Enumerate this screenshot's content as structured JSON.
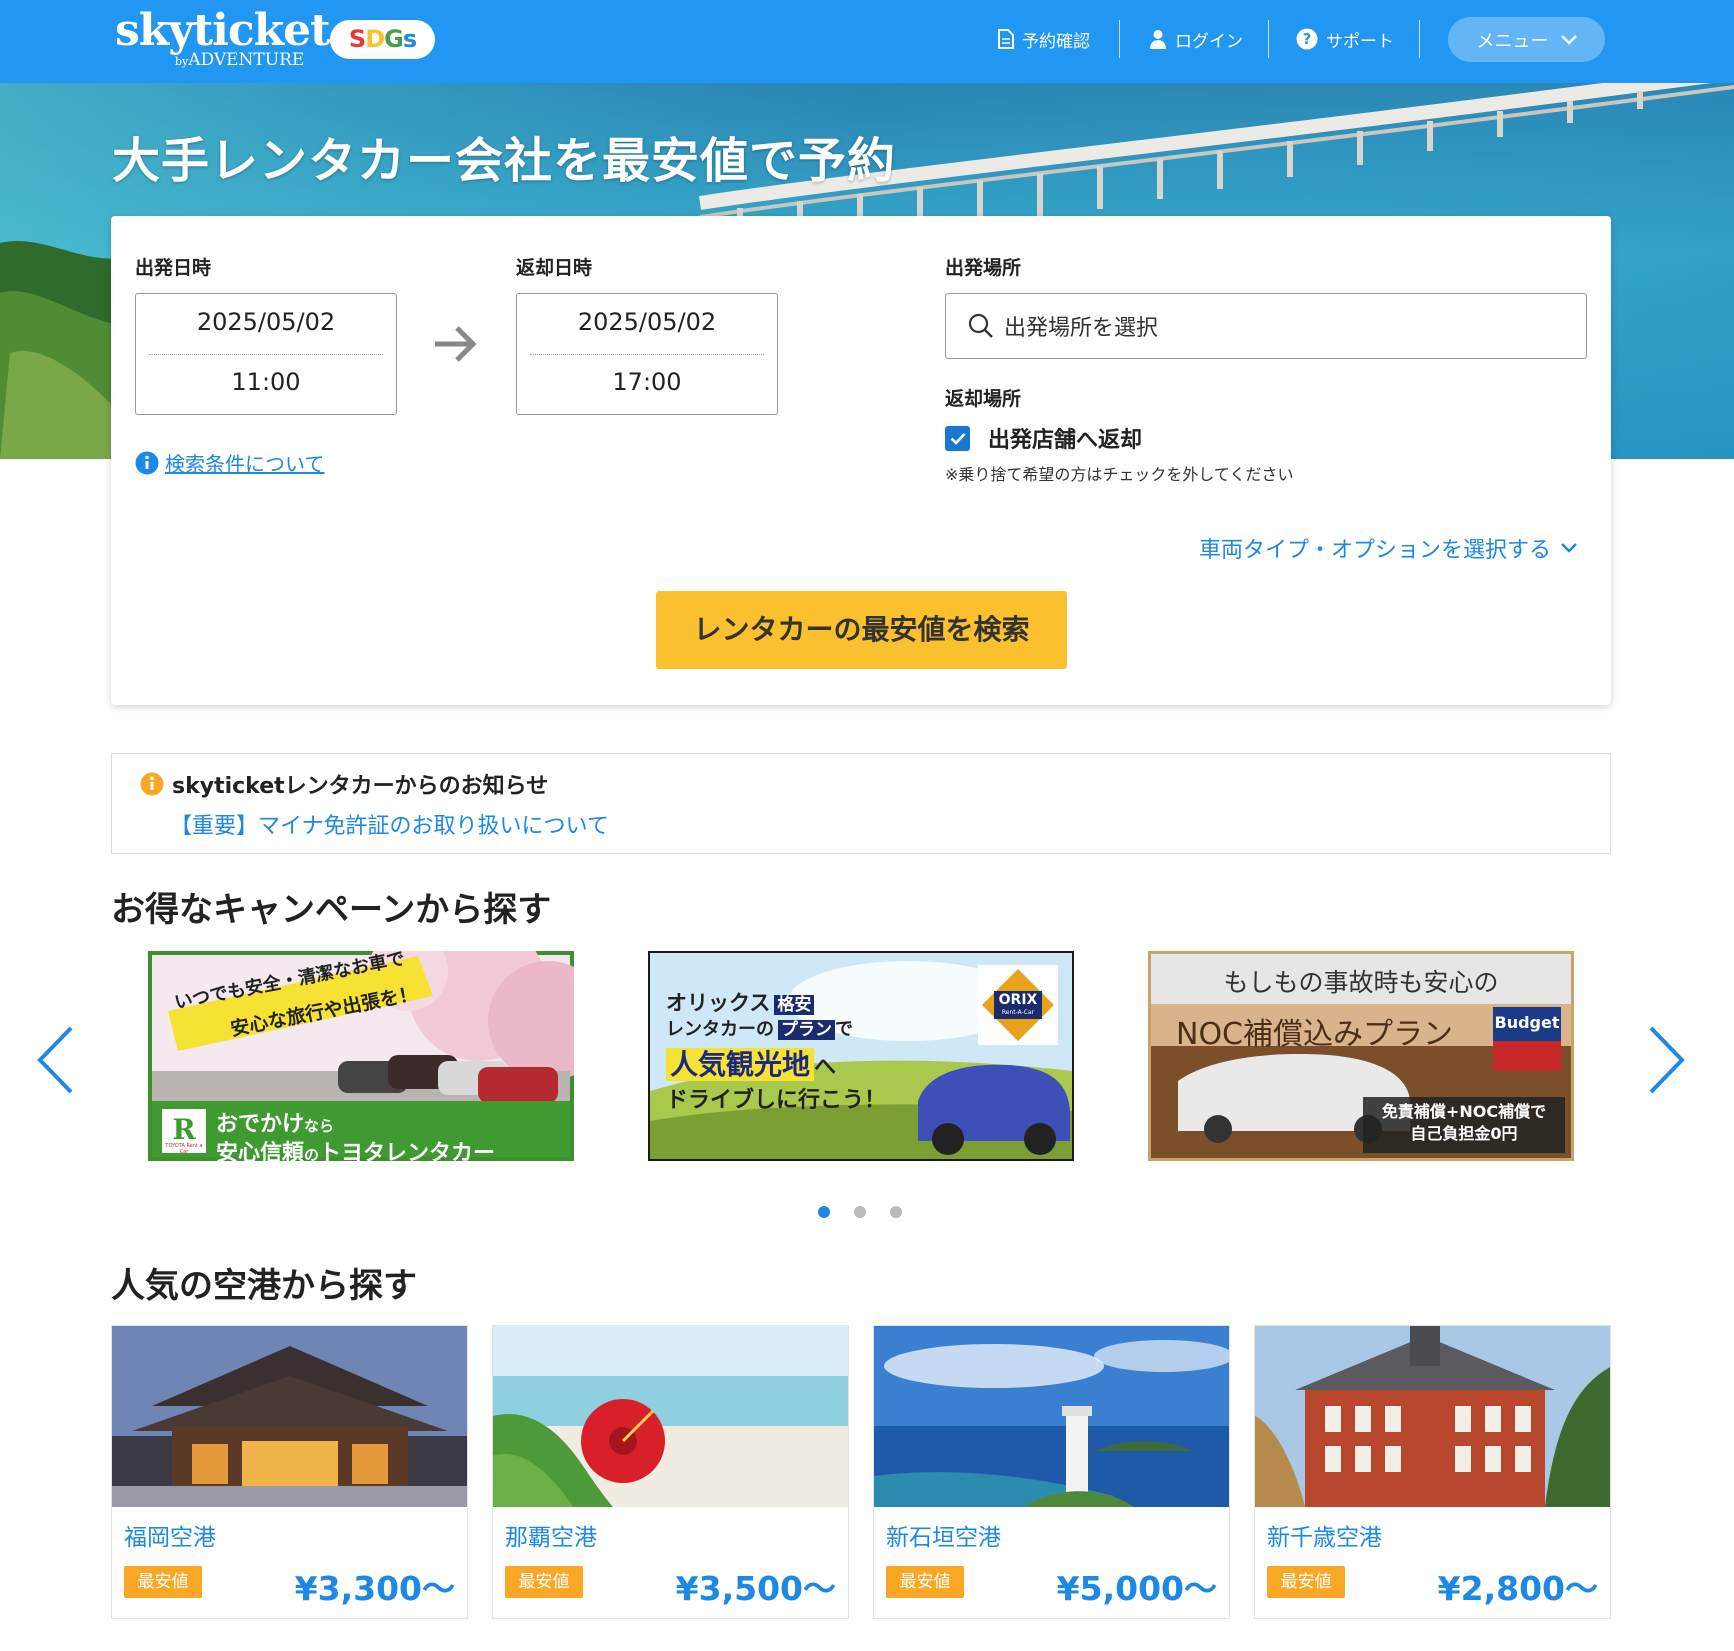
{
  "header": {
    "logo": "skyticket",
    "logo_sub_by": "by",
    "logo_sub_brand": "ADVENTURE",
    "sdgs": {
      "s1": "S",
      "d": "D",
      "g": "G",
      "s2": "s"
    },
    "nav": {
      "reservation": "予約確認",
      "login": "ログイン",
      "support": "サポート",
      "menu": "メニュー"
    },
    "icons": {
      "reservation": "document-icon",
      "login": "person-icon",
      "support": "question-circle-icon",
      "menu": "chevron-down-icon"
    }
  },
  "hero": {
    "title": "大手レンタカー会社を最安値で予約"
  },
  "search": {
    "departure_label": "出発日時",
    "departure_date": "2025/05/02",
    "departure_time": "11:00",
    "return_label": "返却日時",
    "return_date": "2025/05/02",
    "return_time": "17:00",
    "place_label": "出発場所",
    "place_placeholder": "出発場所を選択",
    "return_place_label": "返却場所",
    "same_store_label": "出発店舗へ返却",
    "same_store_checked": true,
    "note": "※乗り捨て希望の方はチェックを外してください",
    "conditions_link": "検索条件について",
    "options_link": "車両タイプ・オプションを選択する",
    "search_button": "レンタカーの最安値を検索"
  },
  "notice": {
    "title": "skyticketレンタカーからのお知らせ",
    "link": "【重要】マイナ免許証のお取り扱いについて"
  },
  "campaigns": {
    "title": "お得なキャンペーンから探す",
    "banners": [
      {
        "line1": "いつでも安全・清潔なお車で",
        "line2": "安心な旅行や出張を！",
        "bottom_a": "おでかけ",
        "bottom_b": "なら",
        "bottom_c": "安心信頼",
        "bottom_d": "の",
        "bottom_e": "トヨタレンタカー",
        "logo_text": "TOYOTA Rent a Car"
      },
      {
        "line1a": "オリックス",
        "tag1": "格安",
        "line1b": "レンタカーの",
        "tag2": "プラン",
        "line1c": "で",
        "line2": "人気観光地",
        "line2b": "へ",
        "line3": "ドライブしに行こう！",
        "logo": "ORIX",
        "logo_sub": "Rent-A-Car"
      },
      {
        "line1": "もしもの事故時も安心の",
        "line2": "NOC補償込みプラン",
        "logo": "Budget",
        "box1": "免責補償+NOC補償で",
        "box2": "自己負担金0円"
      }
    ],
    "active_dot": 0,
    "dot_count": 3
  },
  "airports": {
    "title": "人気の空港から探す",
    "badge": "最安値",
    "items": [
      {
        "name": "福岡空港",
        "price": "¥3,300〜"
      },
      {
        "name": "那覇空港",
        "price": "¥3,500〜"
      },
      {
        "name": "新石垣空港",
        "price": "¥5,000〜"
      },
      {
        "name": "新千歳空港",
        "price": "¥2,800〜"
      }
    ]
  },
  "colors": {
    "header_bg": "#2196f3",
    "accent_blue": "#1e88e5",
    "button_yellow": "#fbc02d",
    "badge_orange": "#f9a825"
  }
}
